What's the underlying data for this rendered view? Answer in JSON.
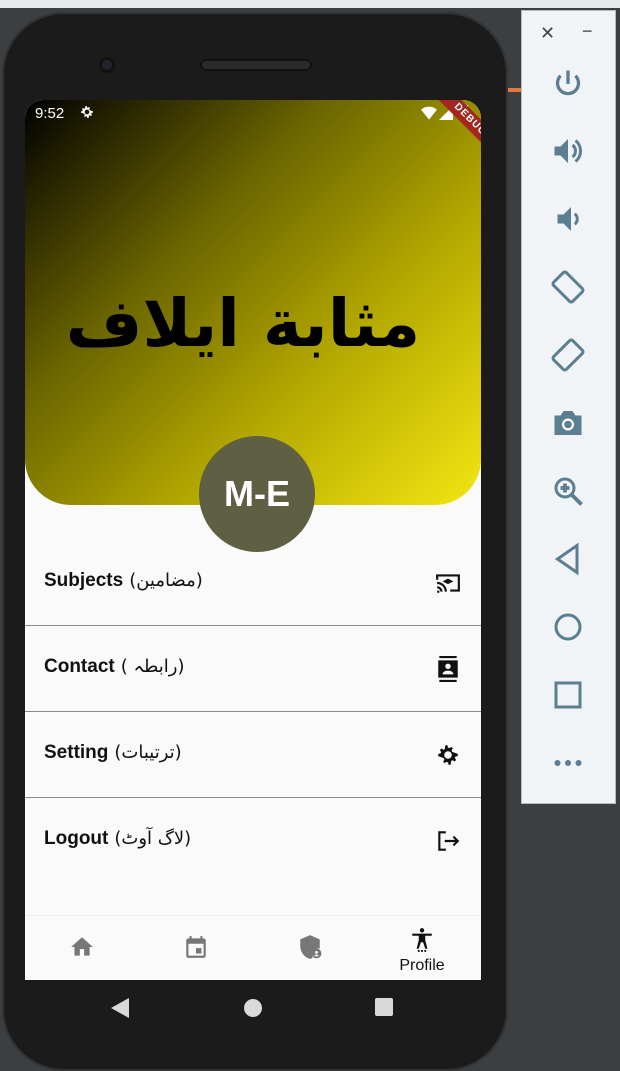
{
  "status": {
    "time": "9:52",
    "debug_banner": "DEBUG"
  },
  "header": {
    "title": "مثابة ايلاف"
  },
  "avatar": {
    "initials": "M-E"
  },
  "menu": [
    {
      "label": "Subjects",
      "sub": "(مضامین)",
      "icon": "cast-for-education-icon"
    },
    {
      "label": "Contact",
      "sub": "( رابطہ)",
      "icon": "contact-card-icon"
    },
    {
      "label": "Setting",
      "sub": "(ترتیبات)",
      "icon": "gear-icon"
    },
    {
      "label": "Logout",
      "sub": "(لاگ آوٹ)",
      "icon": "logout-icon"
    }
  ],
  "bottom_nav": {
    "items": [
      "home-icon",
      "calendar-icon",
      "admin-shield-icon",
      "accessibility-icon"
    ],
    "active_label": "Profile"
  },
  "emulator_panel": {
    "close": "✕",
    "minimize": "−",
    "buttons": [
      "power-icon",
      "volume-up-icon",
      "volume-down-icon",
      "rotate-left-icon",
      "rotate-right-icon",
      "camera-icon",
      "zoom-icon",
      "back-icon",
      "home-icon",
      "overview-icon",
      "more-icon"
    ]
  },
  "colors": {
    "header_gradient_end": "#f3e612",
    "avatar_bg": "#5f5f43",
    "panel_icon": "#5b7e91"
  }
}
